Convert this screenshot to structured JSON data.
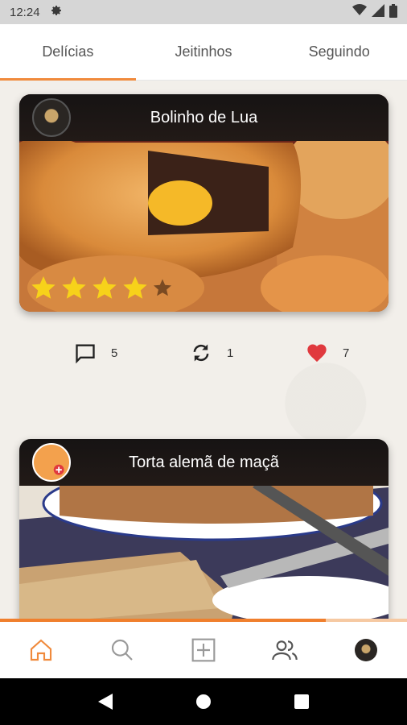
{
  "status_bar": {
    "time": "12:24",
    "icons": [
      "gear-icon",
      "wifi-icon",
      "signal-icon",
      "battery-icon"
    ]
  },
  "tabs": [
    {
      "label": "Delícias",
      "active": true
    },
    {
      "label": "Jeitinhos",
      "active": false
    },
    {
      "label": "Seguindo",
      "active": false
    }
  ],
  "posts": [
    {
      "title": "Bolinho de Lua",
      "rating": 4,
      "max_rating": 5,
      "comments": "5",
      "reposts": "1",
      "likes": "7",
      "liked": true
    },
    {
      "title": "Torta alemã de maçã"
    }
  ],
  "loader_progress": 0.8,
  "bottom_nav": [
    "home-icon",
    "search-icon",
    "add-icon",
    "people-icon",
    "profile-avatar"
  ],
  "colors": {
    "accent": "#f08a3c",
    "like": "#e0393e",
    "star": "#f7d21a"
  }
}
